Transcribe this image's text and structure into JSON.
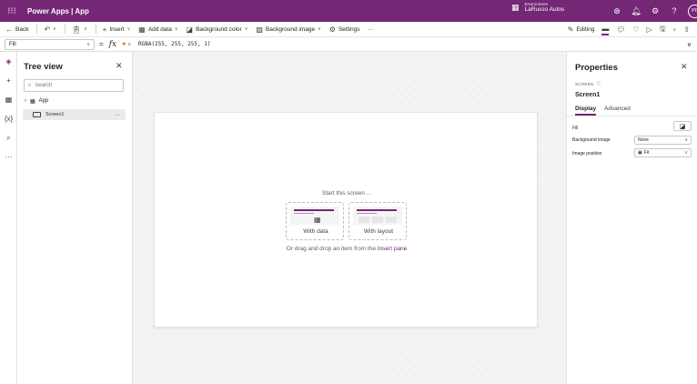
{
  "titlebar": {
    "app_title": "Power Apps  |  App",
    "environment_label": "Environment",
    "environment_name": "LaRusso Autos",
    "avatar_initials": "PF",
    "bg_color": "#742774"
  },
  "commandbar": {
    "back": "Back",
    "insert": "Insert",
    "add_data": "Add data",
    "background_color": "Background color",
    "background_image": "Background image",
    "settings": "Settings",
    "more": "···",
    "editing": "Editing"
  },
  "formulabar": {
    "property": "Fill",
    "equals": "=",
    "fx": "fx",
    "formula": "RGBA(255, 255, 255, 1)"
  },
  "treeview": {
    "title": "Tree view",
    "search_placeholder": "Search",
    "app_label": "App",
    "screen_label": "Screen1",
    "more": "···"
  },
  "canvas": {
    "start_text": "Start this screen ...",
    "with_data": "With data",
    "with_layout": "With layout",
    "drag_text": "Or drag and drop an item from the ",
    "insert_pane_link": "Insert pane"
  },
  "properties": {
    "title": "Properties",
    "type_label": "SCREEN",
    "screen_name": "Screen1",
    "tab_display": "Display",
    "tab_advanced": "Advanced",
    "fill_label": "Fill",
    "background_image_label": "Background image",
    "background_image_value": "None",
    "image_position_label": "Image position",
    "image_position_value": "Fit"
  },
  "colors": {
    "accent": "#742774",
    "canvas_bg": "#f3f3f3"
  }
}
